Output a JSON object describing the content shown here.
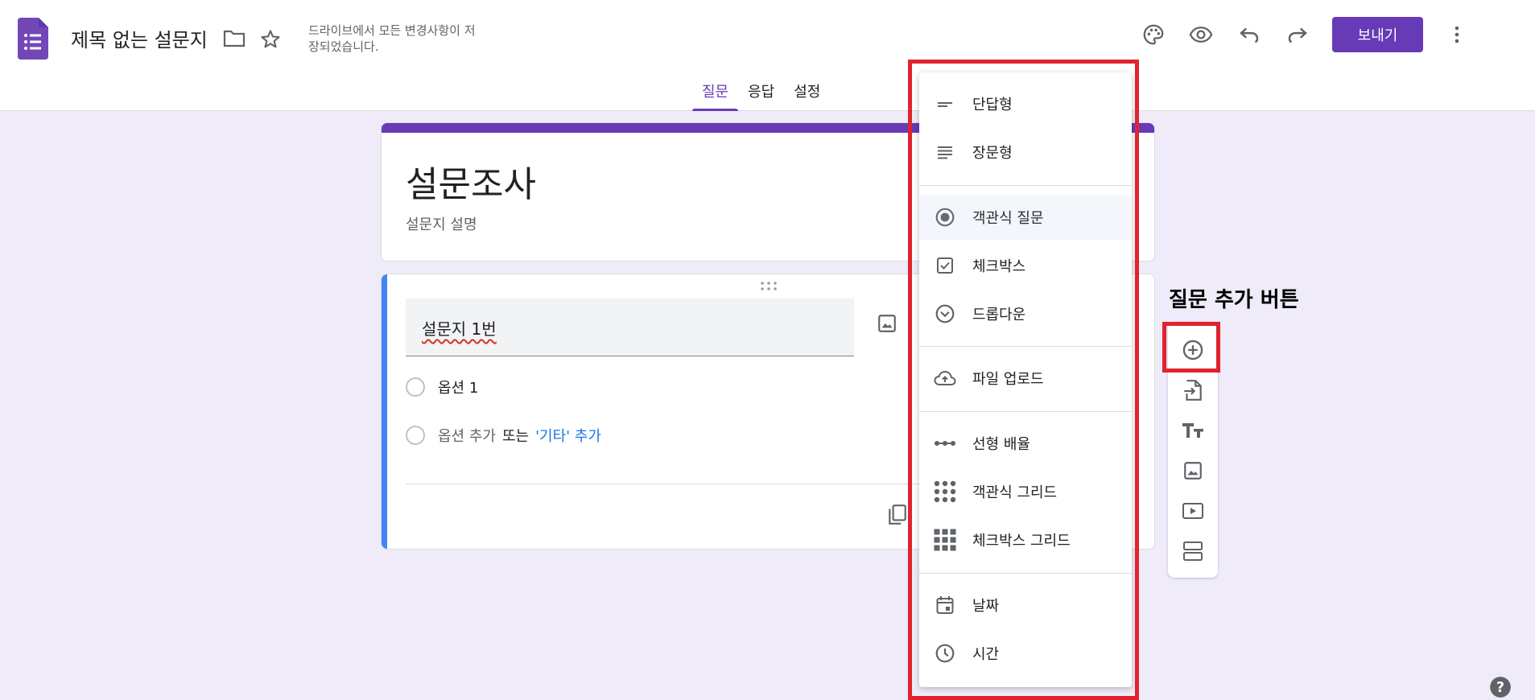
{
  "header": {
    "doc_title": "제목 없는 설문지",
    "save_status": "드라이브에서 모든 변경사항이 저장되었습니다.",
    "send_label": "보내기",
    "icons": [
      "palette-icon",
      "preview-icon",
      "undo-icon",
      "redo-icon",
      "more-vert-icon"
    ]
  },
  "tabs": [
    {
      "label": "질문",
      "active": true
    },
    {
      "label": "응답",
      "active": false
    },
    {
      "label": "설정",
      "active": false
    }
  ],
  "form": {
    "title": "설문조사",
    "description": "설문지 설명"
  },
  "question": {
    "title": "설문지 1번",
    "option1": "옵션 1",
    "add_option": "옵션 추가",
    "or": "또는",
    "add_other": "'기타' 추가"
  },
  "type_menu": {
    "items": [
      {
        "label": "단답형",
        "icon": "short-answer-icon"
      },
      {
        "label": "장문형",
        "icon": "paragraph-icon"
      },
      {
        "label": "객관식 질문",
        "icon": "radio-icon",
        "selected": true
      },
      {
        "label": "체크박스",
        "icon": "checkbox-icon"
      },
      {
        "label": "드롭다운",
        "icon": "dropdown-icon"
      },
      {
        "label": "파일 업로드",
        "icon": "cloud-upload-icon"
      },
      {
        "label": "선형 배율",
        "icon": "linear-scale-icon"
      },
      {
        "label": "객관식 그리드",
        "icon": "dot-grid-icon"
      },
      {
        "label": "체크박스 그리드",
        "icon": "square-grid-icon"
      },
      {
        "label": "날짜",
        "icon": "calendar-icon"
      },
      {
        "label": "시간",
        "icon": "clock-icon"
      }
    ]
  },
  "annotation": {
    "label": "질문 추가 버튼"
  },
  "colors": {
    "accent": "#673ab7",
    "background": "#f0ebf8",
    "highlight": "#e0232e",
    "link": "#1a73e8"
  }
}
